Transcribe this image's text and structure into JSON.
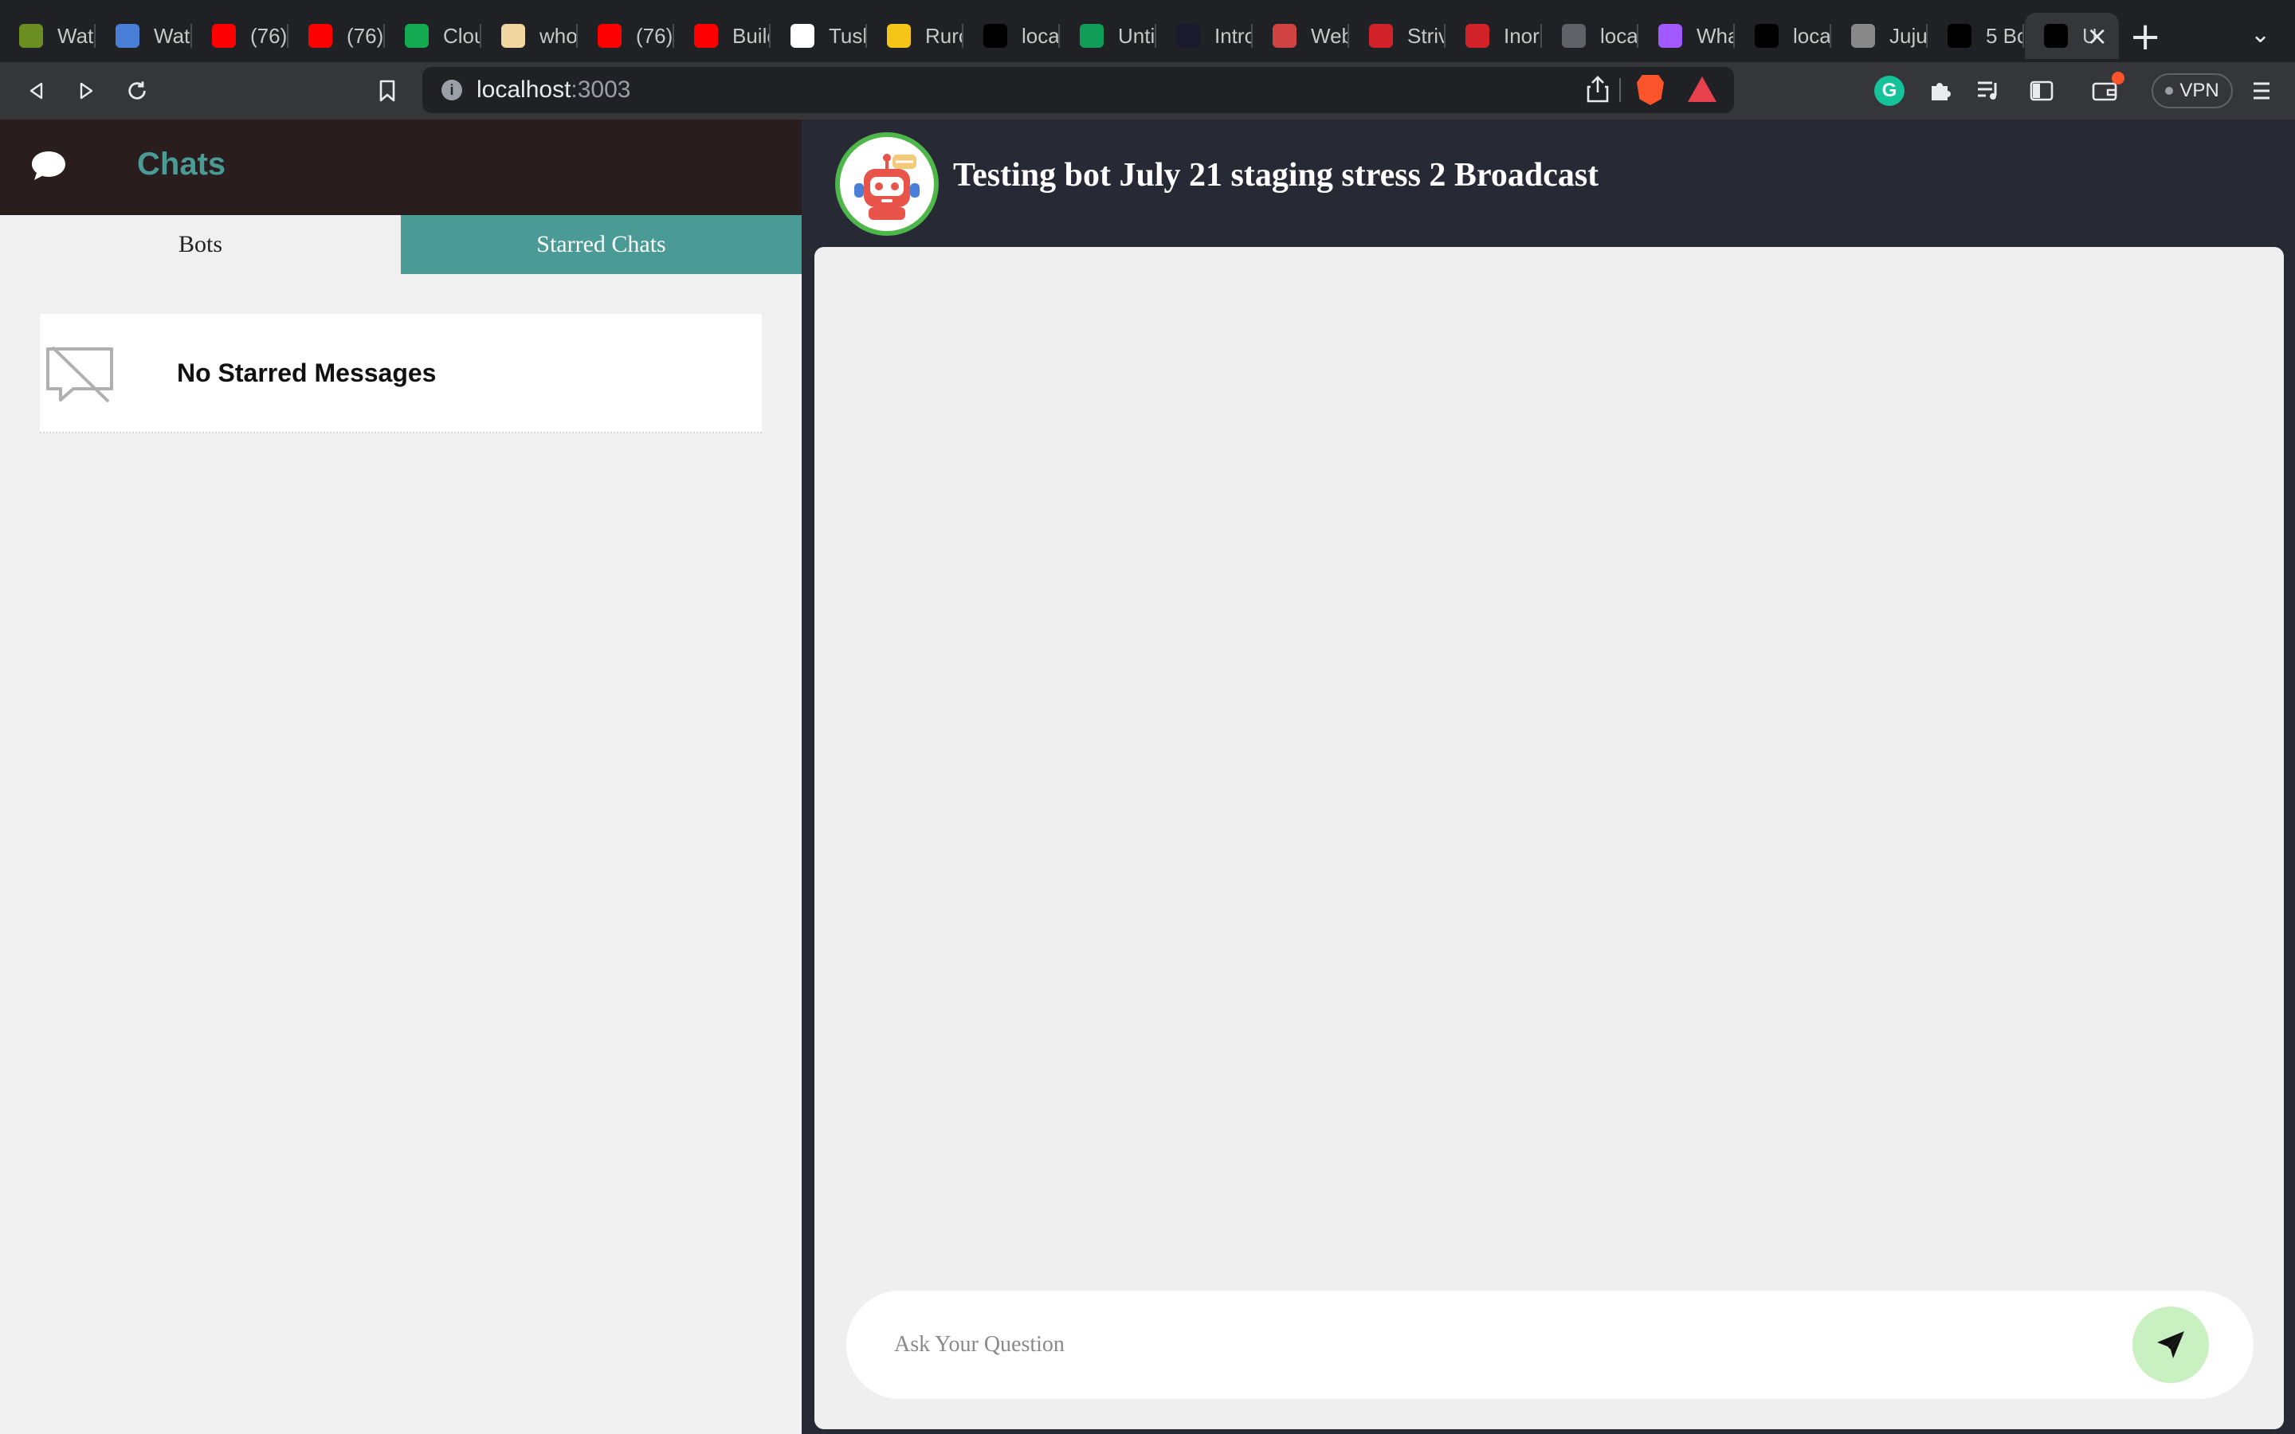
{
  "browser": {
    "tabs": [
      {
        "title": "Watc",
        "icon": "image-favicon",
        "color": "#6b8e23"
      },
      {
        "title": "Watc",
        "icon": "binoculars-favicon",
        "color": "#4a7fd8"
      },
      {
        "title": "(76)",
        "icon": "youtube-favicon",
        "color": "#ff0000"
      },
      {
        "title": "(76)",
        "icon": "youtube-favicon",
        "color": "#ff0000"
      },
      {
        "title": "Clou",
        "icon": "mongodb-leaf-favicon",
        "color": "#13aa52"
      },
      {
        "title": "who",
        "icon": "anime-favicon",
        "color": "#f2d7a0"
      },
      {
        "title": "(76)",
        "icon": "youtube-favicon",
        "color": "#ff0000"
      },
      {
        "title": "Build",
        "icon": "youtube-favicon",
        "color": "#ff0000"
      },
      {
        "title": "Tush",
        "icon": "github-favicon",
        "color": "#ffffff"
      },
      {
        "title": "Ruro",
        "icon": "pikachu-favicon",
        "color": "#f5c518"
      },
      {
        "title": "loca",
        "icon": "vercel-favicon",
        "color": "#000000"
      },
      {
        "title": "Unti",
        "icon": "sheets-favicon",
        "color": "#0f9d58"
      },
      {
        "title": "Intro",
        "icon": "circle-favicon",
        "color": "#1a1a2e"
      },
      {
        "title": "Web",
        "icon": "figure-favicon",
        "color": "#d14343"
      },
      {
        "title": "Striv",
        "icon": "tuf-favicon",
        "color": "#d1222a"
      },
      {
        "title": "Inord",
        "icon": "tuf-favicon",
        "color": "#d1222a"
      },
      {
        "title": "loca",
        "icon": "vercel-favicon",
        "color": "#5f6368"
      },
      {
        "title": "Wha",
        "icon": "figma-favicon",
        "color": "#a259ff"
      },
      {
        "title": "loca",
        "icon": "vercel-favicon",
        "color": "#000000"
      },
      {
        "title": "Juju",
        "icon": "manga-favicon",
        "color": "#888888"
      },
      {
        "title": "5 Bo",
        "icon": "medium-favicon",
        "color": "#000000"
      },
      {
        "title": "U",
        "icon": "vercel-favicon",
        "color": "#000000"
      }
    ],
    "url_host": "localhost",
    "url_port": ":3003",
    "vpn_label": "VPN"
  },
  "app": {
    "sidebar": {
      "title": "Chats",
      "tabs": [
        "Bots",
        "Starred Chats"
      ],
      "active_tab": "Starred Chats",
      "empty_message": "No Starred Messages"
    },
    "chat": {
      "bot_name": "Testing bot July 21 staging stress 2 Broadcast",
      "input_placeholder": "Ask Your Question"
    },
    "colors": {
      "accent": "#4a9a95",
      "sidebar_header": "#2a1d1e",
      "chat_header": "#272a35",
      "send_button": "#c8f0c0"
    }
  }
}
